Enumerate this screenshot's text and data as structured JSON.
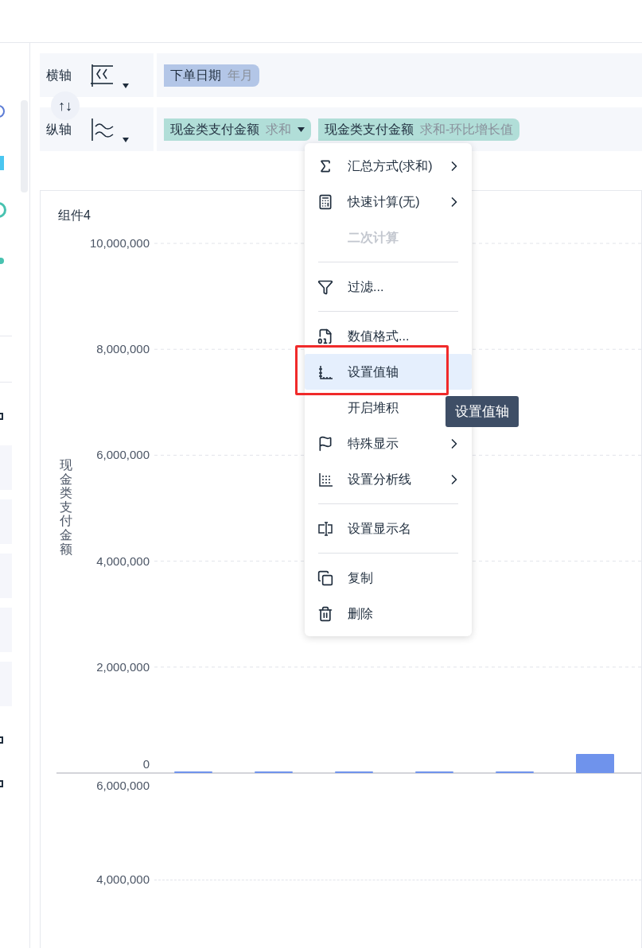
{
  "axes_panel": {
    "rows": [
      {
        "label": "横轴",
        "kind": "horizontal",
        "fields": [
          {
            "name": "下单日期",
            "aggregation": "年月",
            "color": "#b3c6e7",
            "dropdown": false
          }
        ]
      },
      {
        "label": "纵轴",
        "kind": "vertical",
        "fields": [
          {
            "name": "现金类支付金额",
            "aggregation": "求和",
            "color": "#b1ded8",
            "dropdown": true
          },
          {
            "name": "现金类支付金额",
            "aggregation": "求和-环比增长值",
            "color": "#b1ded8",
            "dropdown": false
          }
        ]
      }
    ],
    "swap_button": "↑↓"
  },
  "context_menu": {
    "items": [
      {
        "kind": "item",
        "label": "汇总方式(求和)",
        "submenu": true,
        "disabled": false,
        "highlighted": false
      },
      {
        "kind": "item",
        "label": "快速计算(无)",
        "submenu": true,
        "disabled": false,
        "highlighted": false
      },
      {
        "kind": "item",
        "label": "二次计算",
        "submenu": false,
        "disabled": true,
        "highlighted": false
      },
      {
        "kind": "separator"
      },
      {
        "kind": "item",
        "label": "过滤...",
        "submenu": false,
        "disabled": false,
        "highlighted": false
      },
      {
        "kind": "separator"
      },
      {
        "kind": "item",
        "label": "数值格式...",
        "submenu": false,
        "disabled": false,
        "highlighted": false
      },
      {
        "kind": "item",
        "label": "设置值轴",
        "submenu": false,
        "disabled": false,
        "highlighted": true
      },
      {
        "kind": "item",
        "label": "开启堆积",
        "submenu": false,
        "disabled": false,
        "highlighted": false
      },
      {
        "kind": "item",
        "label": "特殊显示",
        "submenu": true,
        "disabled": false,
        "highlighted": false
      },
      {
        "kind": "item",
        "label": "设置分析线",
        "submenu": true,
        "disabled": false,
        "highlighted": false
      },
      {
        "kind": "separator"
      },
      {
        "kind": "item",
        "label": "设置显示名",
        "submenu": false,
        "disabled": false,
        "highlighted": false
      },
      {
        "kind": "separator"
      },
      {
        "kind": "item",
        "label": "复制",
        "submenu": false,
        "disabled": false,
        "highlighted": false
      },
      {
        "kind": "item",
        "label": "删除",
        "submenu": false,
        "disabled": false,
        "highlighted": false
      }
    ]
  },
  "tooltip": "设置值轴",
  "chart_card": {
    "title": "组件4",
    "chart_data": {
      "type": "bar",
      "ylabel": "现金类支付金额",
      "ylim": [
        0,
        10000000
      ],
      "yticks": [
        {
          "value": 0,
          "label": "0"
        },
        {
          "value": 2000000,
          "label": "2,000,000"
        },
        {
          "value": 4000000,
          "label": "4,000,000"
        },
        {
          "value": 6000000,
          "label": "6,000,000"
        },
        {
          "value": 8000000,
          "label": "8,000,000"
        },
        {
          "value": 10000000,
          "label": "10,000,000"
        }
      ],
      "grid": true,
      "values": [
        30000,
        30000,
        30000,
        30000,
        30000,
        360000
      ]
    },
    "lower_axis_ticks": [
      "6,000,000",
      "4,000,000"
    ]
  }
}
